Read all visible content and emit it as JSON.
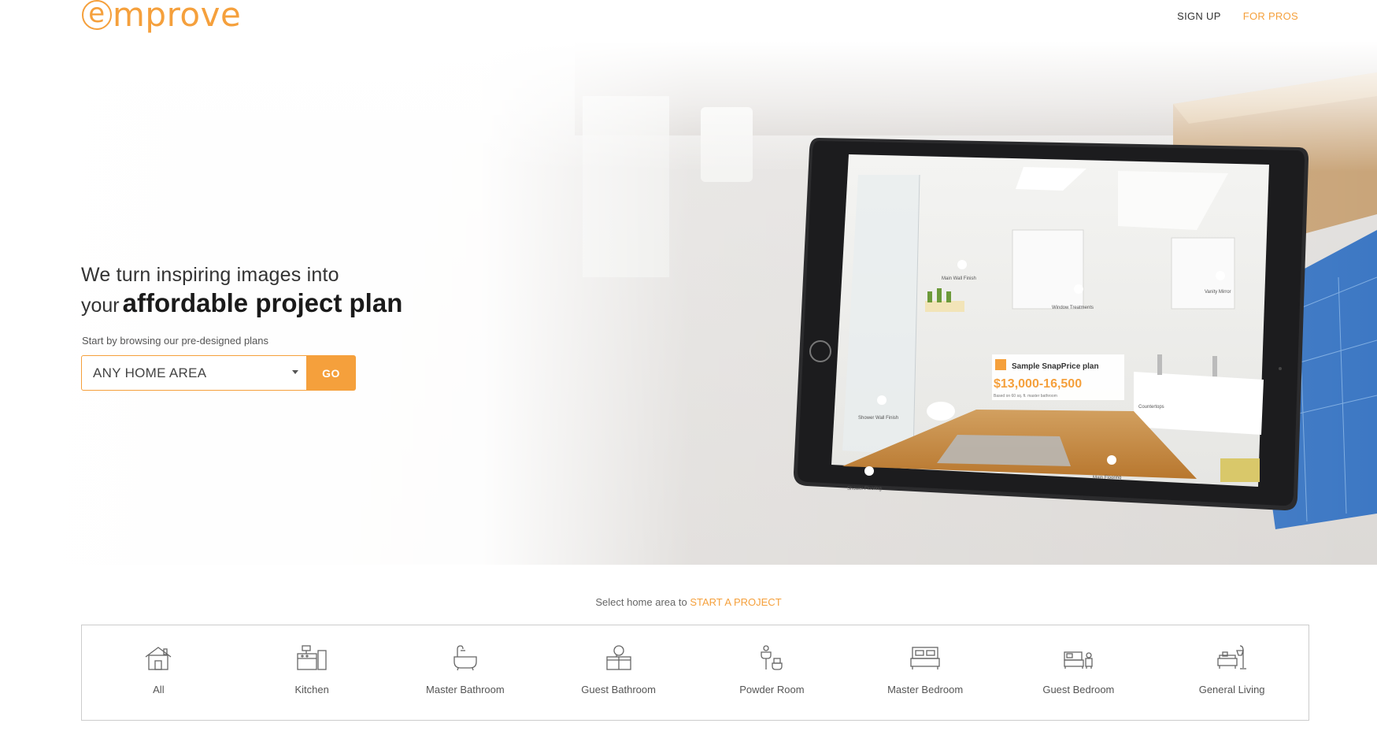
{
  "brand": {
    "logo_e": "e",
    "logo_rest": "mprove",
    "accent": "#f5a03c"
  },
  "nav": {
    "signup": "SIGN UP",
    "for_pros": "FOR PROS"
  },
  "hero": {
    "line1": "We turn inspiring images into",
    "line2_prefix": "your",
    "line2_bold": "affordable project plan",
    "sub": "Start by browsing our pre-designed plans",
    "select_value": "ANY HOME AREA",
    "go_label": "GO"
  },
  "tablet": {
    "plan_title": "Sample SnapPrice plan",
    "plan_price": "$13,000-16,500",
    "plan_note": "Based on 60 sq. ft. master bathroom",
    "tags": [
      "Main Wall Finish",
      "Window Treatments",
      "Vanity Mirror",
      "Shower Wall Finish",
      "Countertops",
      "Main Flooring",
      "Shower Flooring"
    ]
  },
  "bottom": {
    "prompt": "Select home area to",
    "prompt_cta": "START A PROJECT",
    "areas": [
      {
        "label": "All",
        "icon": "house-icon"
      },
      {
        "label": "Kitchen",
        "icon": "kitchen-icon"
      },
      {
        "label": "Master Bathroom",
        "icon": "bathtub-icon"
      },
      {
        "label": "Guest Bathroom",
        "icon": "vanity-icon"
      },
      {
        "label": "Powder Room",
        "icon": "toilet-sink-icon"
      },
      {
        "label": "Master Bedroom",
        "icon": "bed-icon"
      },
      {
        "label": "Guest Bedroom",
        "icon": "small-bed-icon"
      },
      {
        "label": "General Living",
        "icon": "sofa-lamp-icon"
      }
    ]
  }
}
